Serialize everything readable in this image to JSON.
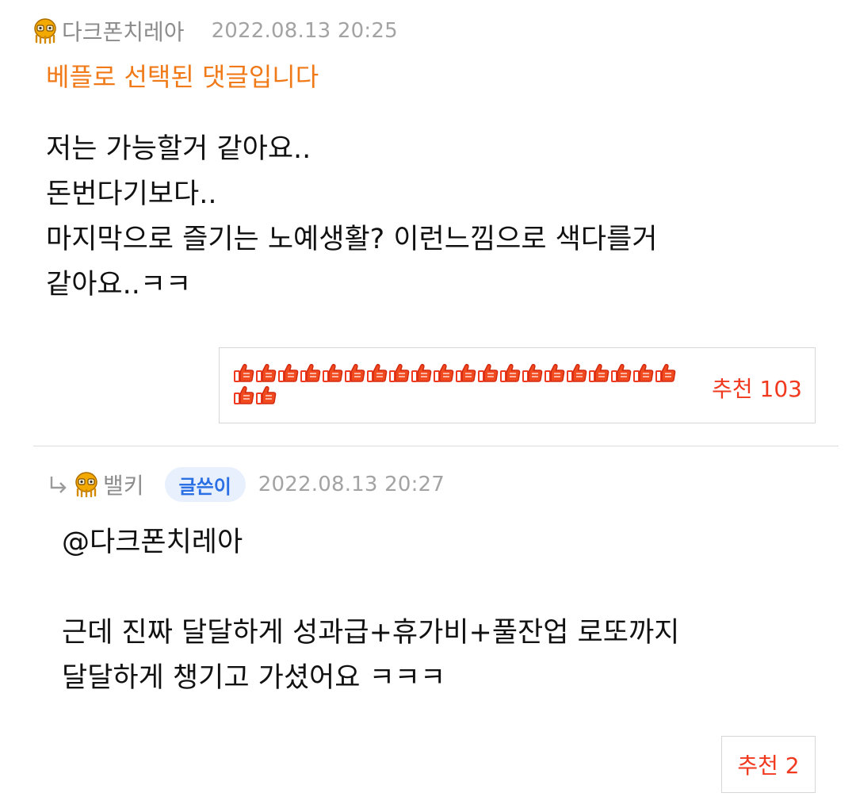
{
  "comment1": {
    "nickname": "다크폰치레아",
    "datetime": "2022.08.13 20:25",
    "best_label": "베플로 선택된 댓글입니다",
    "body": "저는 가능할거 같아요..\n돈번다기보다..\n마지막으로 즐기는 노예생활? 이런느낌으로 색다를거\n같아요..ㅋㅋ",
    "recommend_label": "추천 103",
    "thumb_icon_count": 22,
    "avatar_icon": "level-avatar-icon",
    "thumb_icon": "thumbs-up-icon"
  },
  "comment2": {
    "nickname": "밸키",
    "writer_badge": "글쓴이",
    "datetime": "2022.08.13 20:27",
    "body": "@다크폰치레아\n\n근데 진짜 달달하게 성과급+휴가비+풀잔업 로또까지\n달달하게 챙기고 가셨어요 ㅋㅋㅋ",
    "recommend_label": "추천 2",
    "reply_icon": "reply-arrow-icon",
    "avatar_icon": "level-avatar-icon"
  },
  "colors": {
    "best_label": "#f07918",
    "recommend": "#f0391e",
    "meta_gray": "#8c8c8c",
    "badge_text": "#2a6fe3",
    "badge_bg": "#e8f0fe"
  }
}
